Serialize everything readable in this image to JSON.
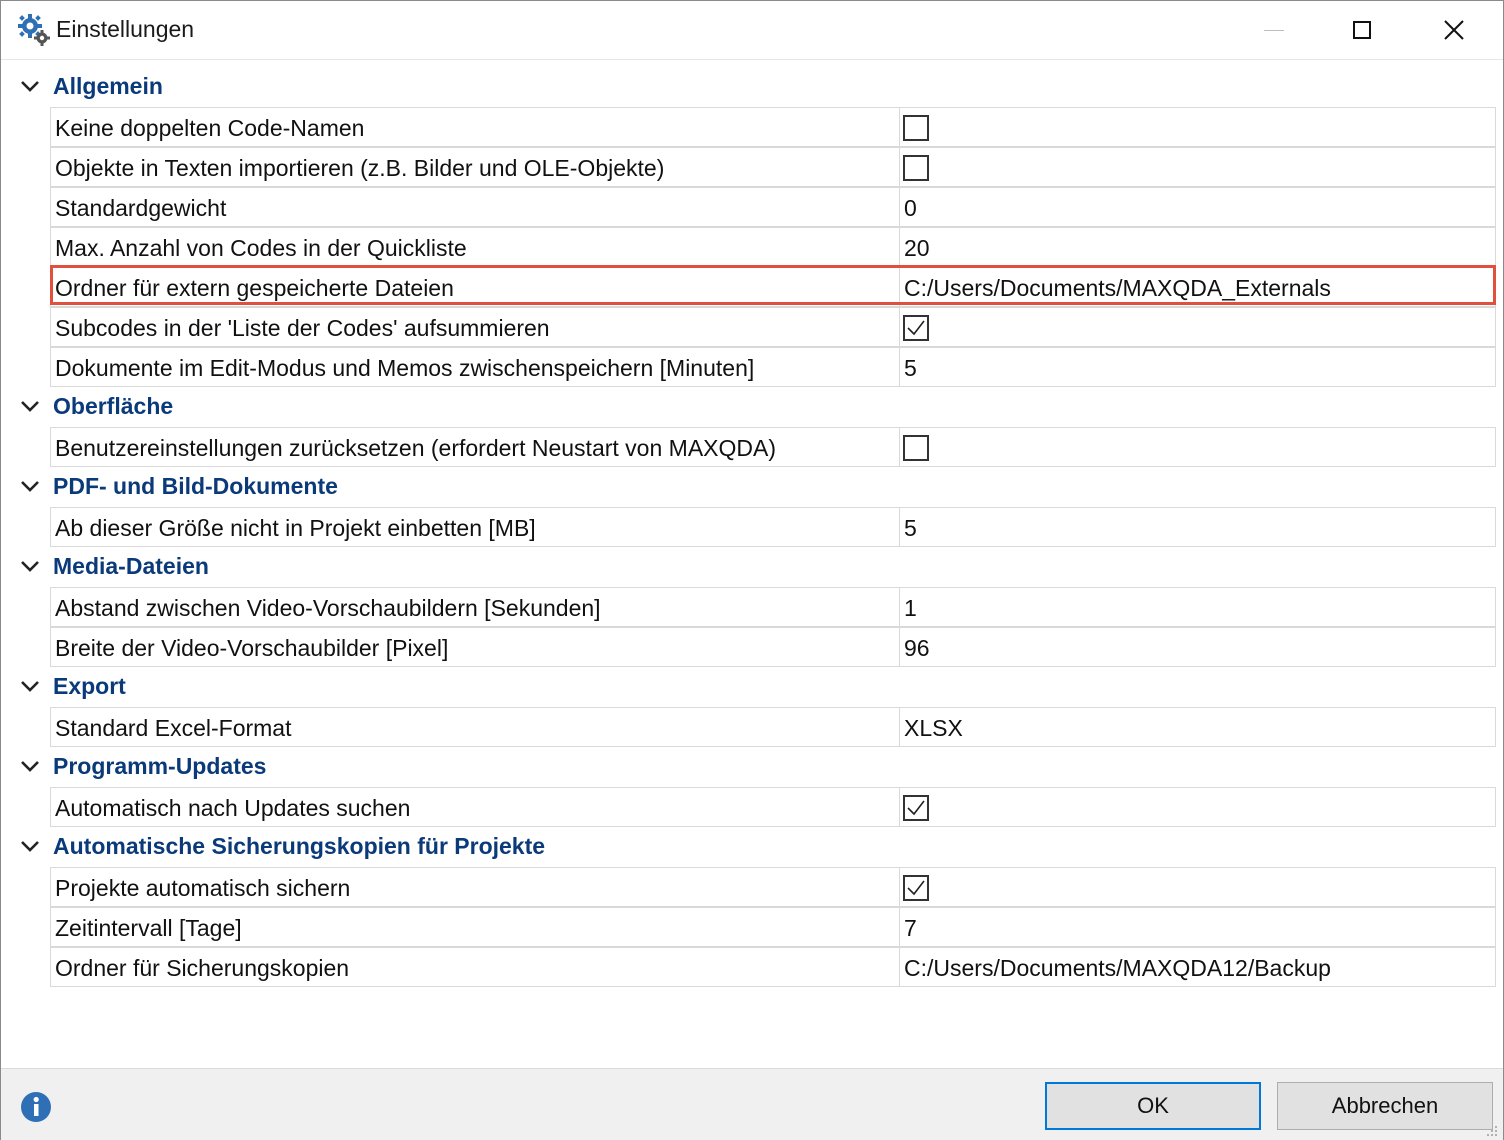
{
  "window": {
    "title": "Einstellungen"
  },
  "categories": [
    {
      "label": "Allgemein",
      "rows": [
        {
          "name": "Keine doppelten Code-Namen",
          "type": "checkbox",
          "checked": false
        },
        {
          "name": "Objekte in Texten importieren (z.B. Bilder und OLE-Objekte)",
          "type": "checkbox",
          "checked": false
        },
        {
          "name": "Standardgewicht",
          "type": "text",
          "value": "0"
        },
        {
          "name": "Max. Anzahl von Codes in der Quickliste",
          "type": "text",
          "value": "20"
        },
        {
          "name": "Ordner für extern gespeicherte Dateien",
          "type": "text",
          "value": "C:/Users/Documents/MAXQDA_Externals",
          "highlighted": true
        },
        {
          "name": "Subcodes in der 'Liste der Codes' aufsummieren",
          "type": "checkbox",
          "checked": true
        },
        {
          "name": "Dokumente im Edit-Modus und Memos zwischenspeichern [Minuten]",
          "type": "text",
          "value": "5"
        }
      ]
    },
    {
      "label": "Oberfläche",
      "rows": [
        {
          "name": "Benutzereinstellungen zurücksetzen (erfordert Neustart von MAXQDA)",
          "type": "checkbox",
          "checked": false
        }
      ]
    },
    {
      "label": "PDF- und Bild-Dokumente",
      "rows": [
        {
          "name": "Ab dieser Größe nicht in Projekt einbetten [MB]",
          "type": "text",
          "value": "5"
        }
      ]
    },
    {
      "label": "Media-Dateien",
      "rows": [
        {
          "name": "Abstand zwischen Video-Vorschaubildern [Sekunden]",
          "type": "text",
          "value": "1"
        },
        {
          "name": "Breite der Video-Vorschaubilder [Pixel]",
          "type": "text",
          "value": "96"
        }
      ]
    },
    {
      "label": "Export",
      "rows": [
        {
          "name": "Standard Excel-Format",
          "type": "text",
          "value": "XLSX"
        }
      ]
    },
    {
      "label": "Programm-Updates",
      "rows": [
        {
          "name": "Automatisch nach Updates suchen",
          "type": "checkbox",
          "checked": true
        }
      ]
    },
    {
      "label": "Automatische Sicherungskopien für Projekte",
      "rows": [
        {
          "name": "Projekte automatisch sichern",
          "type": "checkbox",
          "checked": true
        },
        {
          "name": "Zeitintervall [Tage]",
          "type": "text",
          "value": "7"
        },
        {
          "name": "Ordner für Sicherungskopien",
          "type": "text",
          "value": "C:/Users/Documents/MAXQDA12/Backup"
        }
      ]
    }
  ],
  "footer": {
    "ok_label": "OK",
    "cancel_label": "Abbrechen"
  },
  "colors": {
    "category_text": "#0b3a7a",
    "highlight_border": "#e0503c",
    "ok_border": "#0078d7",
    "info_icon": "#2f6fb5"
  },
  "icons": {
    "title": "gears-icon",
    "info": "info-icon",
    "category_toggle": "chevron-down-icon",
    "checkmark": "checkmark-icon"
  }
}
